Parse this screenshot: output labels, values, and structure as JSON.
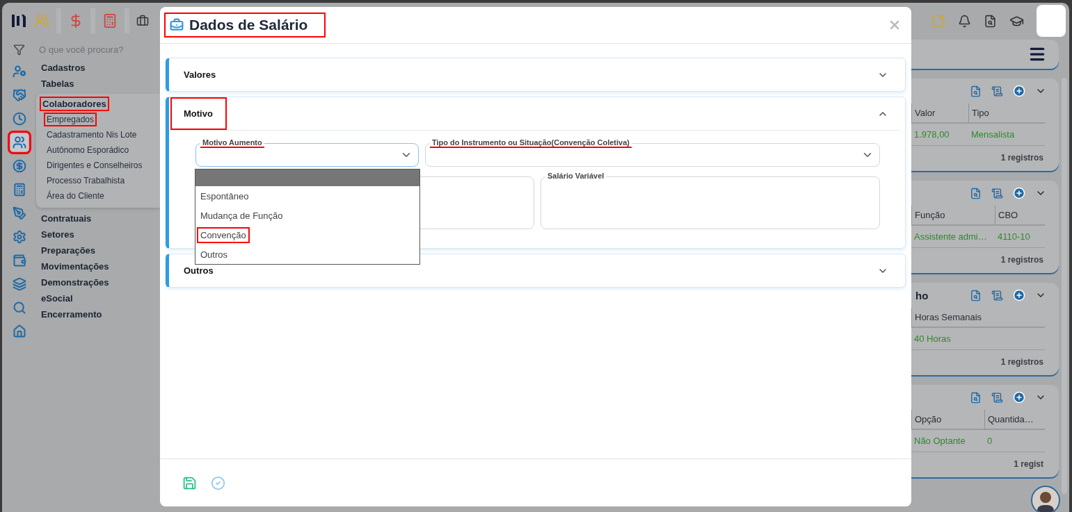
{
  "search": {
    "placeholder": "O que você procura?"
  },
  "rail": [
    {
      "selected": false,
      "annotated": false
    },
    {
      "selected": false,
      "annotated": false
    },
    {
      "selected": false,
      "annotated": false
    },
    {
      "selected": true,
      "annotated": true
    },
    {
      "selected": false,
      "annotated": false
    },
    {
      "selected": false,
      "annotated": false
    },
    {
      "selected": false,
      "annotated": false
    },
    {
      "selected": false,
      "annotated": false
    },
    {
      "selected": false,
      "annotated": false
    },
    {
      "selected": false,
      "annotated": false
    },
    {
      "selected": false,
      "annotated": false
    },
    {
      "selected": false,
      "annotated": false
    }
  ],
  "menu": [
    {
      "label": "Cadastros",
      "annotated": false
    },
    {
      "label": "Tabelas",
      "annotated": false
    },
    {
      "label": "Colaboradores",
      "annotated": true,
      "children": [
        {
          "label": "Empregados",
          "annotated": true
        },
        {
          "label": "Cadastramento Nis Lote",
          "annotated": false
        },
        {
          "label": "Autônomo Esporádico",
          "annotated": false
        },
        {
          "label": "Dirigentes e Conselheiros",
          "annotated": false
        },
        {
          "label": "Processo Trabalhista",
          "annotated": false
        },
        {
          "label": "Área do Cliente",
          "annotated": false
        }
      ]
    },
    {
      "label": "Contratuais",
      "annotated": false
    },
    {
      "label": "Setores",
      "annotated": false
    },
    {
      "label": "Preparações",
      "annotated": false
    },
    {
      "label": "Movimentações",
      "annotated": false
    },
    {
      "label": "Demonstrações",
      "annotated": false
    },
    {
      "label": "eSocial",
      "annotated": false
    },
    {
      "label": "Encerramento",
      "annotated": false
    }
  ],
  "cards": [
    {
      "columns": [
        "Valor",
        "Tipo"
      ],
      "row": [
        "1.978,00",
        "Mensalista"
      ],
      "footer": "1 registros"
    },
    {
      "columns": [
        "Função",
        "CBO"
      ],
      "row": [
        "Assistente admi…",
        "4110-10"
      ],
      "footer": "1 registros"
    },
    {
      "title": "ho",
      "columns": [
        "Horas Semanais"
      ],
      "row": [
        "40 Horas"
      ],
      "footer": "1 registros"
    },
    {
      "columns": [
        "Opção",
        "Quantida…"
      ],
      "row": [
        "Não Optante",
        "0"
      ],
      "footer": "1 regist"
    }
  ],
  "modal": {
    "title": "Dados de Salário",
    "annotated": true,
    "sections": [
      {
        "title": "Valores",
        "expanded": false,
        "annotated": false
      },
      {
        "title": "Motivo",
        "expanded": true,
        "annotated": true,
        "fields": [
          {
            "kind": "select",
            "label": "Motivo Aumento",
            "focused": true,
            "underlined": true
          },
          {
            "kind": "select",
            "label": "Tipo do Instrumento ou Situação(Convenção Coletiva)",
            "focused": false,
            "underlined": true
          },
          {
            "kind": "textarea",
            "focused": false
          },
          {
            "kind": "textarea",
            "label": "Salário Variável",
            "focused": false,
            "underlined": false
          }
        ],
        "dropdown": {
          "blank_highlighted": true,
          "options": [
            {
              "label": "Espontâneo",
              "annotated": false
            },
            {
              "label": "Mudança de Função",
              "annotated": false
            },
            {
              "label": "Convenção",
              "annotated": true
            },
            {
              "label": "Outros",
              "annotated": false
            }
          ]
        }
      },
      {
        "title": "Outros",
        "expanded": false,
        "annotated": false
      }
    ]
  }
}
